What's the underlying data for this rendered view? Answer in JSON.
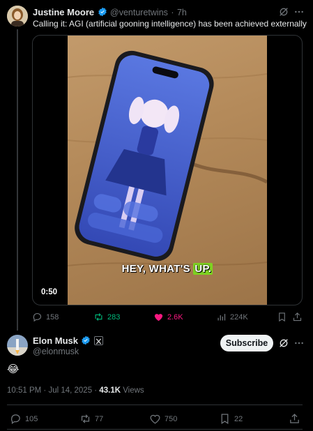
{
  "tweet1": {
    "author_name": "Justine Moore",
    "handle": "@venturetwins",
    "time": "7h",
    "separator": "·",
    "text": "Calling it: AGI (artificial gooning intelligence) has been achieved externally",
    "video": {
      "duration": "0:50",
      "caption_prefix": "HEY, WHAT'S ",
      "caption_highlight": "UP."
    },
    "stats": {
      "replies": "158",
      "reposts": "283",
      "likes": "2.6K",
      "views": "224K"
    }
  },
  "tweet2": {
    "author_name": "Elon Musk",
    "handle": "@elonmusk",
    "subscribe_label": "Subscribe",
    "emoji": "😂",
    "timestamp": "10:51 PM · Jul 14, 2025 · ",
    "views_count": "43.1K",
    "views_label": " Views",
    "stats": {
      "replies": "105",
      "reposts": "77",
      "likes": "750",
      "bookmarks": "22"
    }
  },
  "colors": {
    "verified_blue": "#1d9bf0",
    "repost_green": "#00ba7c",
    "like_pink": "#f91880",
    "caption_highlight": "#7ed321"
  },
  "icons": [
    "grok-icon",
    "more-icon",
    "reply-icon",
    "repost-icon",
    "like-icon",
    "views-icon",
    "bookmark-icon",
    "share-icon",
    "verified-icon",
    "x-affiliate-icon"
  ]
}
